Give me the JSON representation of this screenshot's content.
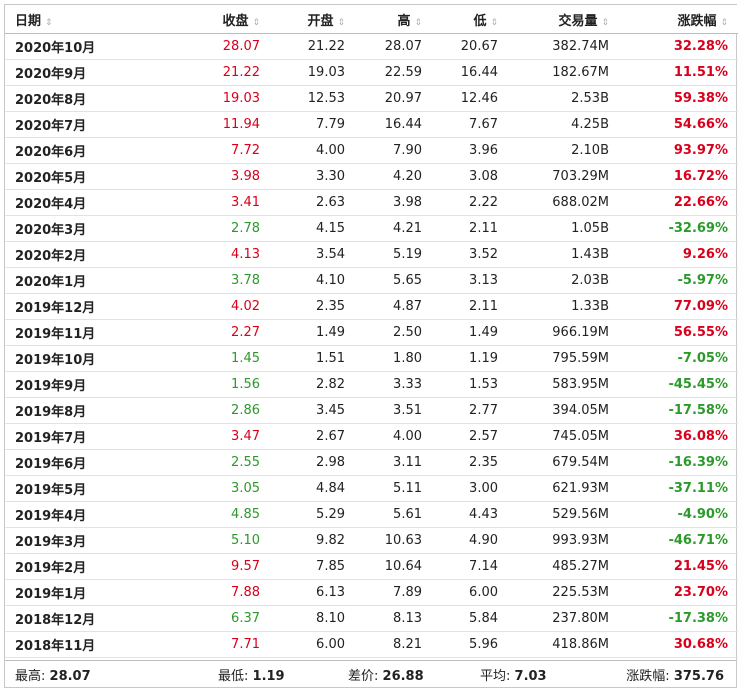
{
  "headers": {
    "date": "日期",
    "close": "收盘",
    "open": "开盘",
    "high": "高",
    "low": "低",
    "volume": "交易量",
    "change": "涨跌幅",
    "sort_icon": "sort-icon",
    "sort_glyph": "⇕"
  },
  "colors": {
    "up": "#d9001b",
    "down": "#2b9a2b"
  },
  "rows": [
    {
      "date": "2020年10月",
      "close": "28.07",
      "open": "21.22",
      "high": "28.07",
      "low": "20.67",
      "volume": "382.74M",
      "change": "32.28%",
      "dir": "up"
    },
    {
      "date": "2020年9月",
      "close": "21.22",
      "open": "19.03",
      "high": "22.59",
      "low": "16.44",
      "volume": "182.67M",
      "change": "11.51%",
      "dir": "up"
    },
    {
      "date": "2020年8月",
      "close": "19.03",
      "open": "12.53",
      "high": "20.97",
      "low": "12.46",
      "volume": "2.53B",
      "change": "59.38%",
      "dir": "up"
    },
    {
      "date": "2020年7月",
      "close": "11.94",
      "open": "7.79",
      "high": "16.44",
      "low": "7.67",
      "volume": "4.25B",
      "change": "54.66%",
      "dir": "up"
    },
    {
      "date": "2020年6月",
      "close": "7.72",
      "open": "4.00",
      "high": "7.90",
      "low": "3.96",
      "volume": "2.10B",
      "change": "93.97%",
      "dir": "up"
    },
    {
      "date": "2020年5月",
      "close": "3.98",
      "open": "3.30",
      "high": "4.20",
      "low": "3.08",
      "volume": "703.29M",
      "change": "16.72%",
      "dir": "up"
    },
    {
      "date": "2020年4月",
      "close": "3.41",
      "open": "2.63",
      "high": "3.98",
      "low": "2.22",
      "volume": "688.02M",
      "change": "22.66%",
      "dir": "up"
    },
    {
      "date": "2020年3月",
      "close": "2.78",
      "open": "4.15",
      "high": "4.21",
      "low": "2.11",
      "volume": "1.05B",
      "change": "-32.69%",
      "dir": "down"
    },
    {
      "date": "2020年2月",
      "close": "4.13",
      "open": "3.54",
      "high": "5.19",
      "low": "3.52",
      "volume": "1.43B",
      "change": "9.26%",
      "dir": "up"
    },
    {
      "date": "2020年1月",
      "close": "3.78",
      "open": "4.10",
      "high": "5.65",
      "low": "3.13",
      "volume": "2.03B",
      "change": "-5.97%",
      "dir": "down"
    },
    {
      "date": "2019年12月",
      "close": "4.02",
      "open": "2.35",
      "high": "4.87",
      "low": "2.11",
      "volume": "1.33B",
      "change": "77.09%",
      "dir": "up"
    },
    {
      "date": "2019年11月",
      "close": "2.27",
      "open": "1.49",
      "high": "2.50",
      "low": "1.49",
      "volume": "966.19M",
      "change": "56.55%",
      "dir": "up"
    },
    {
      "date": "2019年10月",
      "close": "1.45",
      "open": "1.51",
      "high": "1.80",
      "low": "1.19",
      "volume": "795.59M",
      "change": "-7.05%",
      "dir": "down"
    },
    {
      "date": "2019年9月",
      "close": "1.56",
      "open": "2.82",
      "high": "3.33",
      "low": "1.53",
      "volume": "583.95M",
      "change": "-45.45%",
      "dir": "down"
    },
    {
      "date": "2019年8月",
      "close": "2.86",
      "open": "3.45",
      "high": "3.51",
      "low": "2.77",
      "volume": "394.05M",
      "change": "-17.58%",
      "dir": "down"
    },
    {
      "date": "2019年7月",
      "close": "3.47",
      "open": "2.67",
      "high": "4.00",
      "low": "2.57",
      "volume": "745.05M",
      "change": "36.08%",
      "dir": "up"
    },
    {
      "date": "2019年6月",
      "close": "2.55",
      "open": "2.98",
      "high": "3.11",
      "low": "2.35",
      "volume": "679.54M",
      "change": "-16.39%",
      "dir": "down"
    },
    {
      "date": "2019年5月",
      "close": "3.05",
      "open": "4.84",
      "high": "5.11",
      "low": "3.00",
      "volume": "621.93M",
      "change": "-37.11%",
      "dir": "down"
    },
    {
      "date": "2019年4月",
      "close": "4.85",
      "open": "5.29",
      "high": "5.61",
      "low": "4.43",
      "volume": "529.56M",
      "change": "-4.90%",
      "dir": "down"
    },
    {
      "date": "2019年3月",
      "close": "5.10",
      "open": "9.82",
      "high": "10.63",
      "low": "4.90",
      "volume": "993.93M",
      "change": "-46.71%",
      "dir": "down"
    },
    {
      "date": "2019年2月",
      "close": "9.57",
      "open": "7.85",
      "high": "10.64",
      "low": "7.14",
      "volume": "485.27M",
      "change": "21.45%",
      "dir": "up"
    },
    {
      "date": "2019年1月",
      "close": "7.88",
      "open": "6.13",
      "high": "7.89",
      "low": "6.00",
      "volume": "225.53M",
      "change": "23.70%",
      "dir": "up"
    },
    {
      "date": "2018年12月",
      "close": "6.37",
      "open": "8.10",
      "high": "8.13",
      "low": "5.84",
      "volume": "237.80M",
      "change": "-17.38%",
      "dir": "down"
    },
    {
      "date": "2018年11月",
      "close": "7.71",
      "open": "6.00",
      "high": "8.21",
      "low": "5.96",
      "volume": "418.86M",
      "change": "30.68%",
      "dir": "up"
    }
  ],
  "footer": {
    "high_label": "最高:",
    "high_value": "28.07",
    "low_label": "最低:",
    "low_value": "1.19",
    "diff_label": "差价:",
    "diff_value": "26.88",
    "avg_label": "平均:",
    "avg_value": "7.03",
    "change_label": "涨跌幅:",
    "change_value": "375.76"
  }
}
